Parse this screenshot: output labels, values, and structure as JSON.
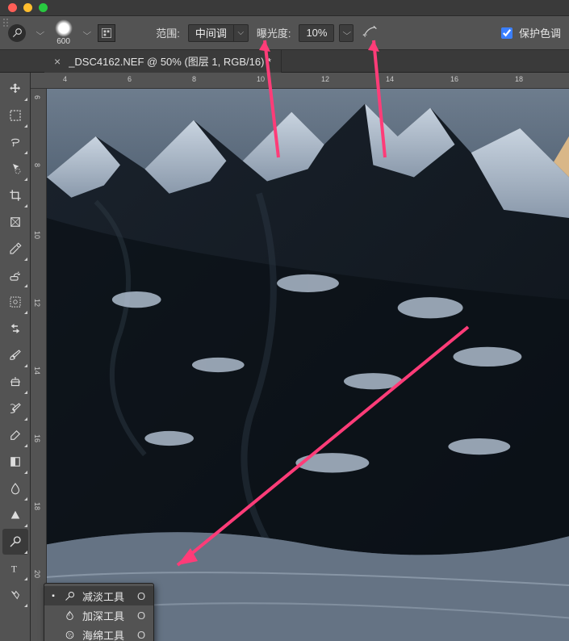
{
  "window": {
    "traffic": [
      "close",
      "minimize",
      "zoom"
    ]
  },
  "optionsbar": {
    "tool_icon": "dodge-tool-icon",
    "brush_size": "600",
    "panel_icon": "brush-panel-icon",
    "range_label": "范围:",
    "range_value": "中间调",
    "exposure_label": "曝光度:",
    "exposure_value": "10%",
    "airbrush_icon": "airbrush-icon",
    "protect_tones_label": "保护色调"
  },
  "tab": {
    "title": "_DSC4162.NEF @ 50% (图层 1, RGB/16) *",
    "close": "×"
  },
  "toolbar": [
    "move-tool",
    "marquee-tool",
    "lasso-tool",
    "magic-wand-tool",
    "crop-tool",
    "eyedropper-tool",
    "healing-brush-tool",
    "brush-tool",
    "clone-stamp-tool",
    "history-brush-tool",
    "eraser-tool",
    "gradient-tool",
    "blur-tool",
    "dodge-tool",
    "pen-tool",
    "type-tool",
    "path-select-tool",
    "rectangle-tool",
    "hand-tool",
    "zoom-tool"
  ],
  "toolbar_displayed": [
    "move",
    "rect-marquee",
    "lasso",
    "quick-select",
    "crop",
    "frame",
    "eyedropper",
    "spot-heal",
    "stamp",
    "cog",
    "swap",
    "brush",
    "stamp2",
    "history",
    "eraser",
    "fill",
    "triangle",
    "dodge",
    "type",
    "rect"
  ],
  "flyout": {
    "items": [
      {
        "icon": "dodge-icon",
        "label": "减淡工具",
        "shortcut": "O",
        "active": true
      },
      {
        "icon": "burn-icon",
        "label": "加深工具",
        "shortcut": "O",
        "active": false
      },
      {
        "icon": "sponge-icon",
        "label": "海绵工具",
        "shortcut": "O",
        "active": false
      }
    ]
  },
  "ruler": {
    "horizontal": [
      "4",
      "6",
      "8",
      "10",
      "12",
      "14",
      "16",
      "18"
    ],
    "vertical": [
      "6",
      "8",
      "10",
      "12",
      "14",
      "16",
      "18",
      "20"
    ]
  }
}
